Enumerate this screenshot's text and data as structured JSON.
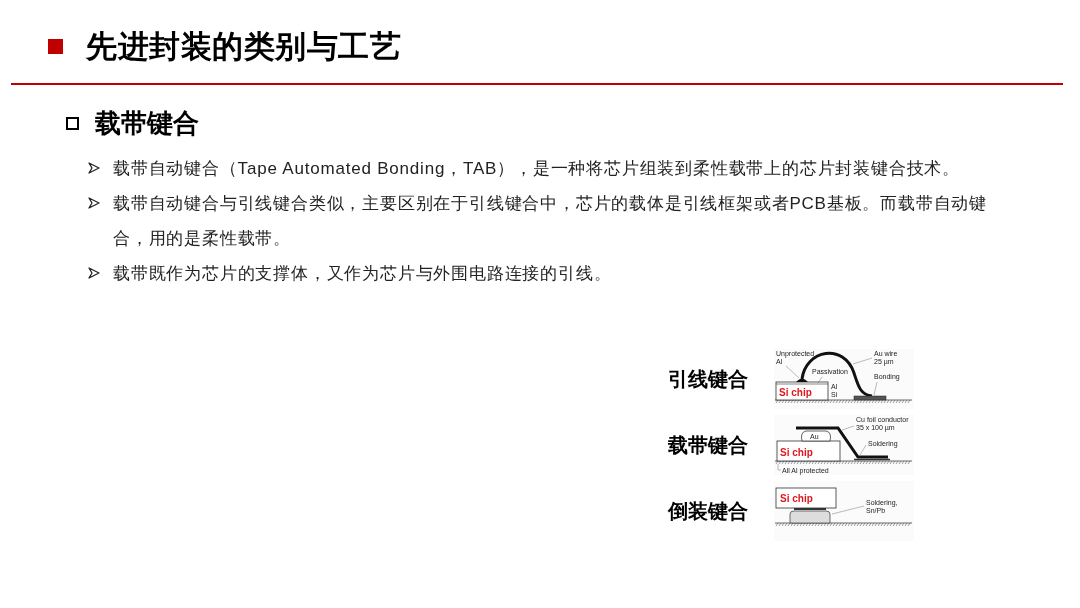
{
  "header": {
    "title": "先进封装的类别与工艺"
  },
  "section": {
    "heading": "载带键合",
    "bullets": [
      "载带自动键合（Tape Automated Bonding，TAB），是一种将芯片组装到柔性载带上的芯片封装键合技术。",
      "载带自动键合与引线键合类似，主要区别在于引线键合中，芯片的载体是引线框架或者PCB基板。而载带自动键合，用的是柔性载带。",
      "载带既作为芯片的支撑体，又作为芯片与外围电路连接的引线。"
    ]
  },
  "figures": [
    {
      "label": "引线键合",
      "kind": "wire",
      "chip_label": "Si chip",
      "callouts": [
        [
          "Unprotected",
          "Al"
        ],
        [
          "Au wire",
          "25 µm"
        ],
        [
          "Passivation"
        ],
        [
          "Al"
        ],
        [
          "Si"
        ],
        [
          "Bonding"
        ]
      ]
    },
    {
      "label": "载带键合",
      "kind": "tape",
      "chip_label": "Si chip",
      "callouts": [
        [
          "Au"
        ],
        [
          "Cu foil conductor",
          "35 x 100 µm"
        ],
        [
          "Soldering"
        ],
        [
          "All Al protected"
        ]
      ]
    },
    {
      "label": "倒装键合",
      "kind": "flip",
      "chip_label": "Si chip",
      "callouts": [
        [
          "Soldering,",
          "Sn/Pb"
        ]
      ]
    }
  ]
}
